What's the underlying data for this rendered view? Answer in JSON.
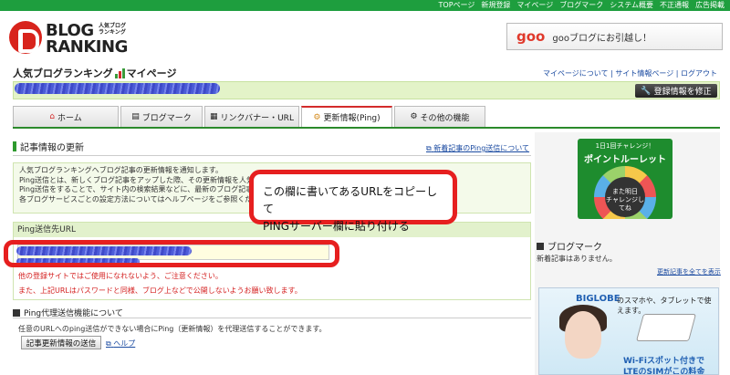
{
  "topnav": [
    "TOPページ",
    "新規登録",
    "マイページ",
    "ブログマーク",
    "システム概要",
    "不正通報",
    "広告掲載"
  ],
  "logo": {
    "line1": "BLOG",
    "line2": "RANKING",
    "sub1": "人気ブログ",
    "sub2": "ランキング"
  },
  "goo": {
    "logo": "goo",
    "text": "gooブログにお引越し！"
  },
  "mypage": {
    "title_pre": "人気ブログランキング",
    "title_post": "マイページ"
  },
  "toplinks": {
    "about": "マイページについて",
    "info": "サイト情報ページ",
    "logout": "ログアウト",
    "sep": "|"
  },
  "edit_button": "登録情報を修正",
  "tabs": [
    {
      "label": "ホーム",
      "icon": "home-icon"
    },
    {
      "label": "ブログマーク",
      "icon": "bookmark-icon"
    },
    {
      "label": "リンクバナー・URL",
      "icon": "banner-icon"
    },
    {
      "label": "更新情報(Ping)",
      "icon": "gear-icon",
      "active": true
    },
    {
      "label": "その他の機能",
      "icon": "gear-icon"
    }
  ],
  "section": {
    "title": "記事情報の更新",
    "ping_link": "新着記事のPing送信について"
  },
  "notice": [
    "人気ブログランキングへブログ記事の更新情報を通知します。",
    "Ping送信とは、新しくブログ記事をアップした際、その更新情報を人気ブ",
    "Ping送信をすることで、サイト内の検索結果などに、最新のブログ記事を",
    "各ブログサービスごとの設定方法についてはヘルプページをご参照くださ"
  ],
  "callout": {
    "line1": "この欄に書いてあるURLをコピーして",
    "line2": "PINGサーバー欄に貼り付ける"
  },
  "ping_box": {
    "header": "Ping送信先URL",
    "warn1": "他の登録サイトではご使用になれないよう、ご注意ください。",
    "warn2": "また、上記URLはパスワードと同様、ブログ上などで公開しないようお願い致します。"
  },
  "proxy": {
    "title": "Ping代理送信機能について",
    "text": "任意のURLへのping送信ができない場合にPing（更新情報）を代理送信することができます。",
    "button": "記事更新情報の送信",
    "help": "ヘルプ"
  },
  "roulette": {
    "top": "1日1回チャレンジ！",
    "title": "ポイントルーレット",
    "center1": "また明日",
    "center2": "チャレンジしてね"
  },
  "sidebar": {
    "title": "ブログマーク",
    "empty": "新着記事はありません。",
    "more": "更新記事を全てを表示"
  },
  "ad": {
    "brand": "BIGLOBE",
    "tagline": "のスマホや、タブレットで使えます。",
    "wifi": "Wi-Fiスポット付きで",
    "lte": "LTEのSIMがこの料金"
  },
  "colors": {
    "nav_green": "#1e9e3e",
    "accent_red": "#e61f1f",
    "link_blue": "#1a4aa0",
    "light_green": "#e3f3c8"
  }
}
